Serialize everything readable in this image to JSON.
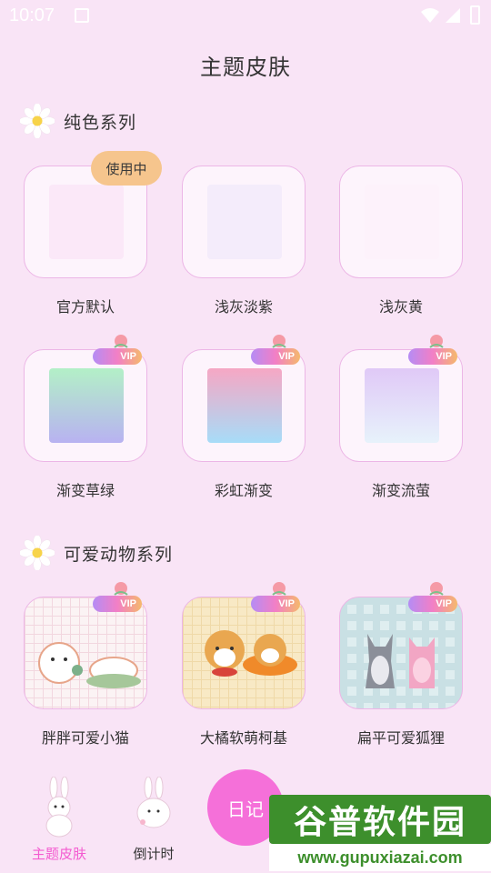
{
  "status_bar": {
    "time": "10:07"
  },
  "header": {
    "title": "主题皮肤"
  },
  "sections": [
    {
      "title": "纯色系列",
      "items": [
        {
          "name": "官方默认",
          "badge": "使用中",
          "swatch": "#fbe8f8"
        },
        {
          "name": "浅灰淡紫",
          "swatch": "#f4ecfb"
        },
        {
          "name": "浅灰黄",
          "swatch": "#fdf2fb"
        }
      ]
    },
    {
      "items": [
        {
          "name": "渐变草绿",
          "vip": "VIP",
          "colors": [
            "#b3f0c7",
            "#b8b2f1"
          ]
        },
        {
          "name": "彩虹渐变",
          "vip": "VIP",
          "colors": [
            "#f6a7c4",
            "#a7dcf8"
          ]
        },
        {
          "name": "渐变流萤",
          "vip": "VIP",
          "colors": [
            "#e0c9f7",
            "#e7f2fb"
          ]
        }
      ]
    },
    {
      "title": "可爱动物系列",
      "items": [
        {
          "name": "胖胖可爱小猫",
          "vip": "VIP",
          "icon": "fluffy-cats"
        },
        {
          "name": "大橘软萌柯基",
          "vip": "VIP",
          "icon": "shiba-dogs"
        },
        {
          "name": "扁平可爱狐狸",
          "vip": "VIP",
          "icon": "fox-and-cat"
        }
      ]
    }
  ],
  "bottom_nav": {
    "items": [
      {
        "label": "主题皮肤",
        "active": true,
        "icon": "bunny-icon"
      },
      {
        "label": "倒计时",
        "icon": "bunny-icon"
      }
    ],
    "center_label": "日记"
  },
  "watermark": {
    "top": "谷普软件园",
    "bottom": "www.gupuxiazai.com"
  },
  "colors": {
    "background": "#f9e4f6",
    "accent": "#f45bd0",
    "badge": "#f6c58d"
  }
}
